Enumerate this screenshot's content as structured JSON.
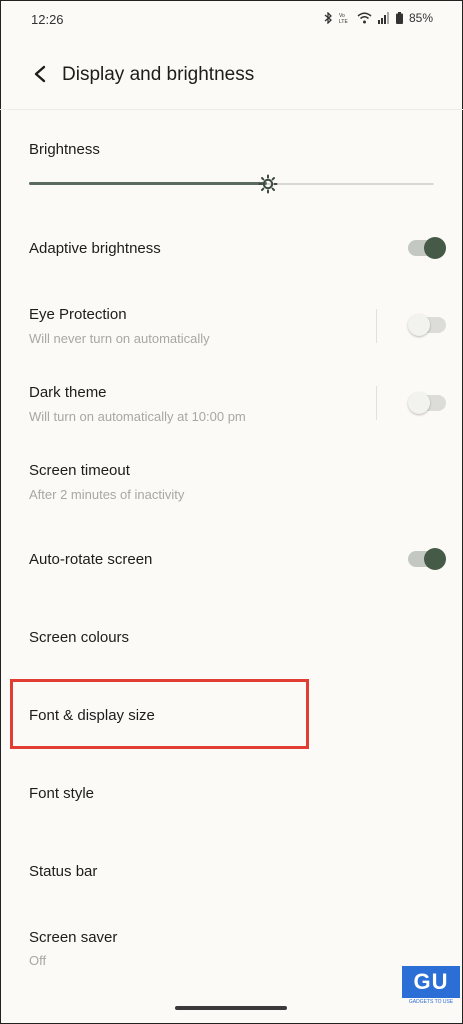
{
  "status": {
    "time": "12:26",
    "network_label": "VoLTE",
    "battery": "85%"
  },
  "header": {
    "title": "Display and brightness"
  },
  "brightness": {
    "label": "Brightness",
    "level": 0.59
  },
  "settings": [
    {
      "title": "Adaptive brightness",
      "subtitle": "",
      "toggle": true
    },
    {
      "title": "Eye Protection",
      "subtitle": "Will never turn on automatically",
      "toggle": false
    },
    {
      "title": "Dark theme",
      "subtitle": "Will turn on automatically at 10:00 pm",
      "toggle": false
    },
    {
      "title": "Screen timeout",
      "subtitle": "After 2 minutes of inactivity"
    },
    {
      "title": "Auto-rotate screen",
      "subtitle": "",
      "toggle": true
    },
    {
      "title": "Screen colours",
      "subtitle": ""
    },
    {
      "title": "Font & display size",
      "subtitle": ""
    },
    {
      "title": "Font style",
      "subtitle": ""
    },
    {
      "title": "Status bar",
      "subtitle": ""
    },
    {
      "title": "Screen saver",
      "subtitle": "Off"
    }
  ],
  "watermark": {
    "logo": "GU",
    "text": "GADGETS TO USE"
  },
  "colors": {
    "accent": "#465a48",
    "highlight": "#e23d33",
    "background": "#fbfaf7"
  }
}
